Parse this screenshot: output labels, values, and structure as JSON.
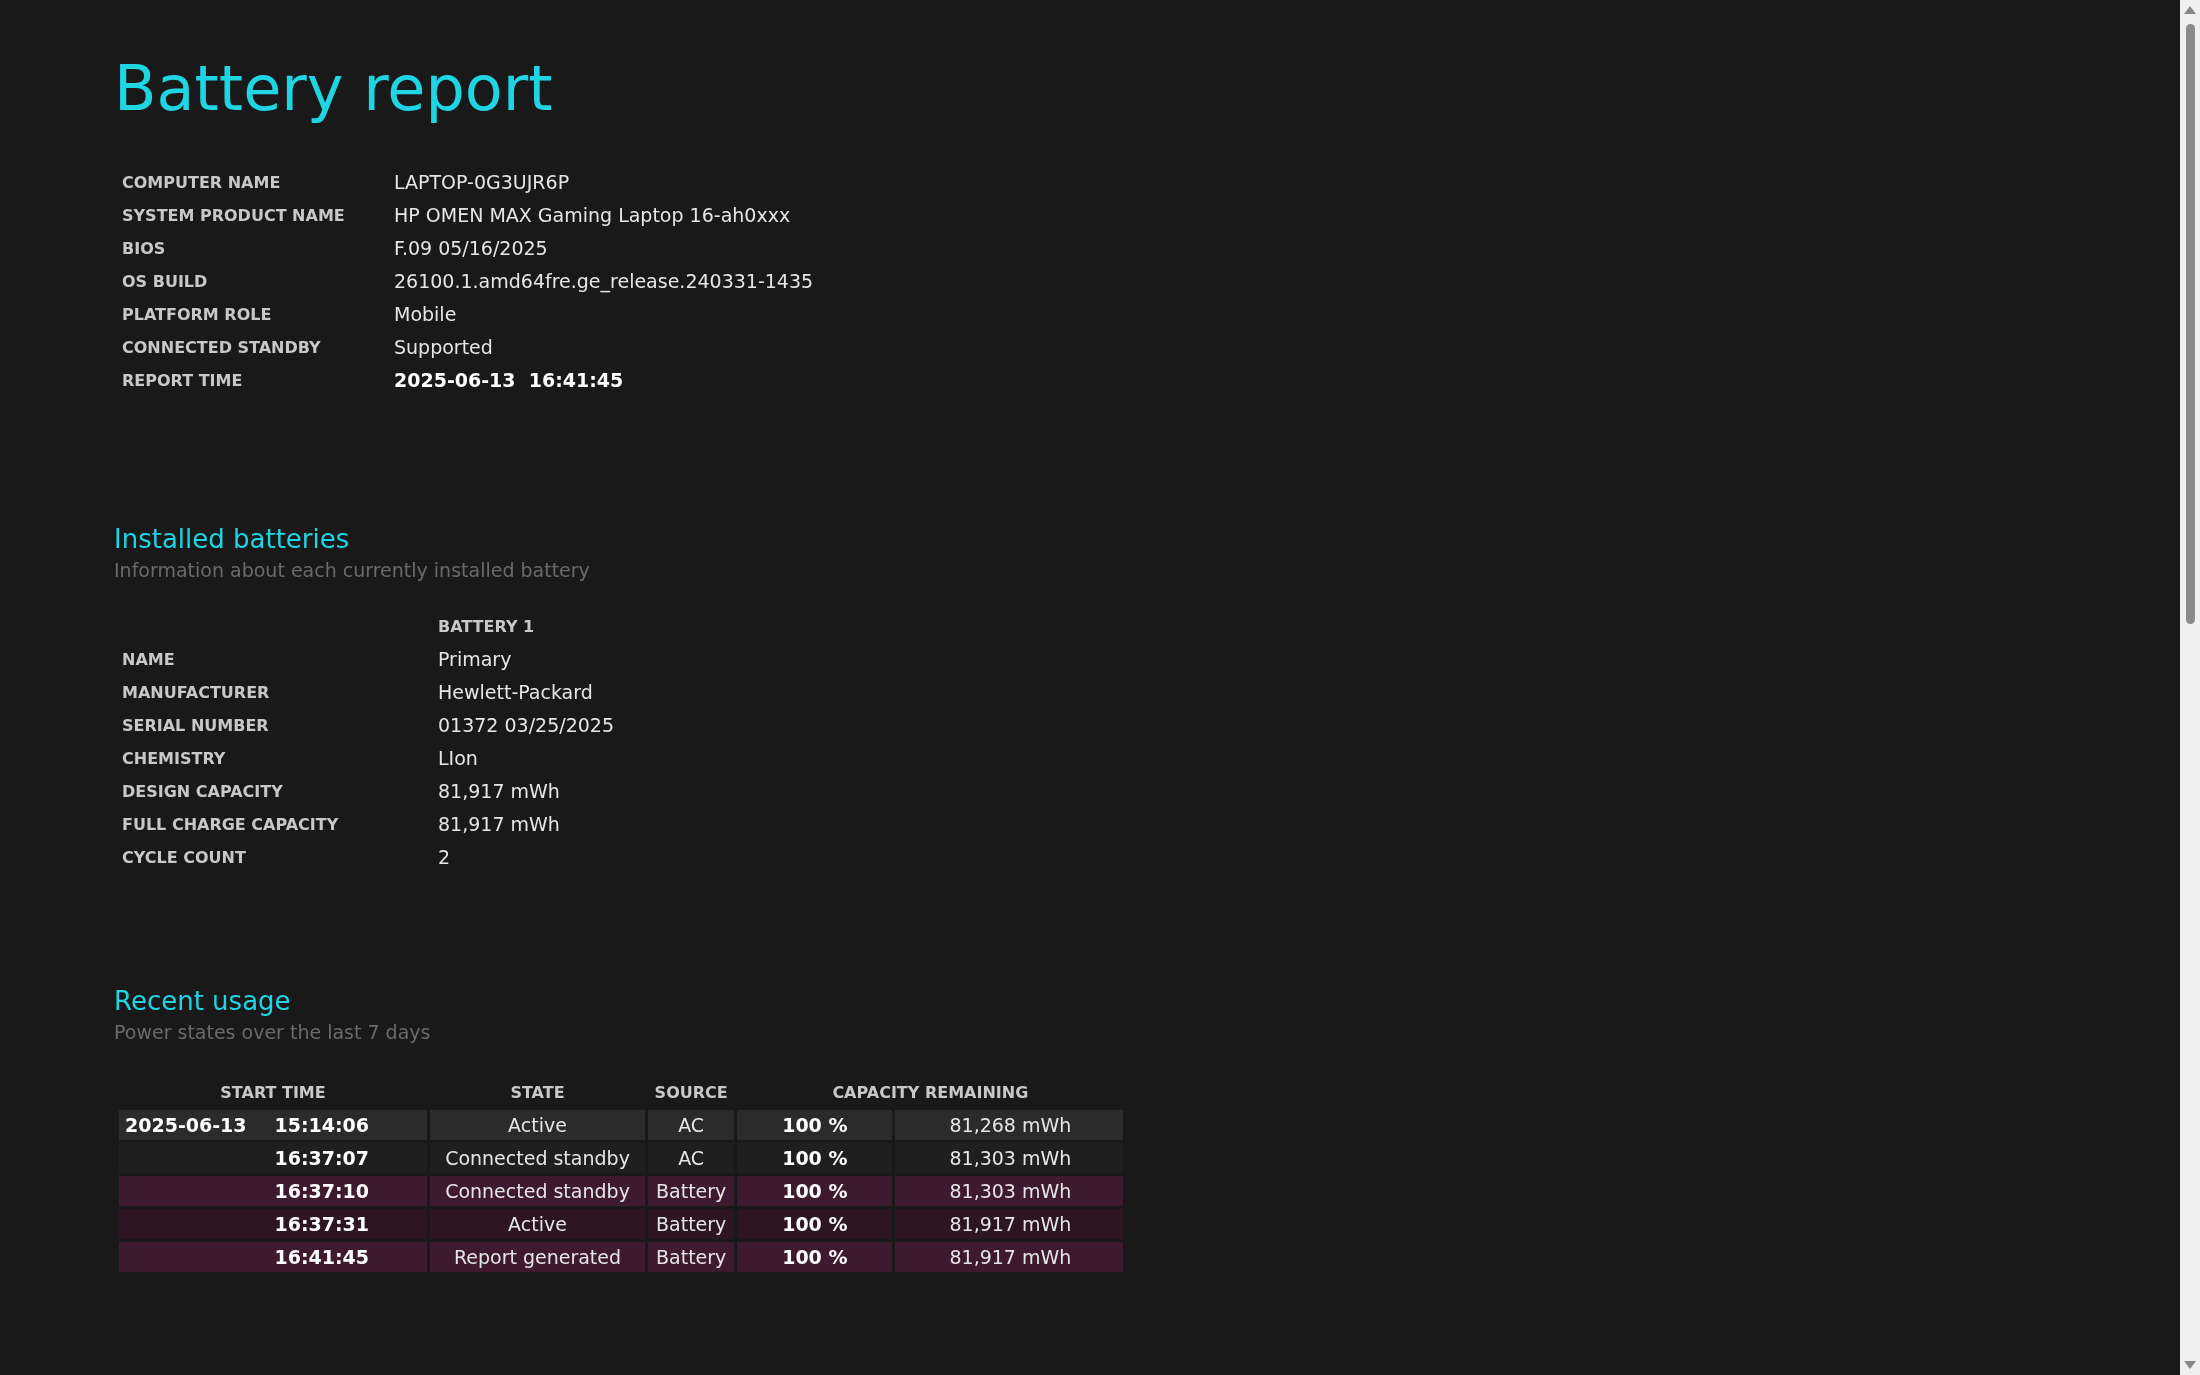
{
  "title": "Battery report",
  "system_info": [
    {
      "label": "COMPUTER NAME",
      "value": "LAPTOP-0G3UJR6P",
      "bold": false
    },
    {
      "label": "SYSTEM PRODUCT NAME",
      "value": "HP OMEN MAX Gaming Laptop 16-ah0xxx",
      "bold": false
    },
    {
      "label": "BIOS",
      "value": "F.09 05/16/2025",
      "bold": false
    },
    {
      "label": "OS BUILD",
      "value": "26100.1.amd64fre.ge_release.240331-1435",
      "bold": false
    },
    {
      "label": "PLATFORM ROLE",
      "value": "Mobile",
      "bold": false
    },
    {
      "label": "CONNECTED STANDBY",
      "value": "Supported",
      "bold": false
    },
    {
      "label": "REPORT TIME",
      "value": "2025-06-13  16:41:45",
      "bold": true
    }
  ],
  "installed_batteries": {
    "heading": "Installed batteries",
    "subtitle": "Information about each currently installed battery",
    "column": "BATTERY 1",
    "rows": [
      {
        "label": "NAME",
        "value": "Primary"
      },
      {
        "label": "MANUFACTURER",
        "value": "Hewlett-Packard"
      },
      {
        "label": "SERIAL NUMBER",
        "value": "01372 03/25/2025"
      },
      {
        "label": "CHEMISTRY",
        "value": "LIon"
      },
      {
        "label": "DESIGN CAPACITY",
        "value": "81,917 mWh"
      },
      {
        "label": "FULL CHARGE CAPACITY",
        "value": "81,917 mWh"
      },
      {
        "label": "CYCLE COUNT",
        "value": "2"
      }
    ]
  },
  "recent_usage": {
    "heading": "Recent usage",
    "subtitle": "Power states over the last 7 days",
    "columns": [
      "START TIME",
      "STATE",
      "SOURCE",
      "CAPACITY REMAINING"
    ],
    "rows": [
      {
        "kind": "ac",
        "date": "2025-06-13",
        "time": "15:14:06",
        "state": "Active",
        "source": "AC",
        "percent": "100 %",
        "capacity": "81,268 mWh"
      },
      {
        "kind": "ac",
        "time": "16:37:07",
        "state": "Connected standby",
        "source": "AC",
        "percent": "100 %",
        "capacity": "81,303 mWh"
      },
      {
        "kind": "battery",
        "time": "16:37:10",
        "state": "Connected standby",
        "source": "Battery",
        "percent": "100 %",
        "capacity": "81,303 mWh"
      },
      {
        "kind": "battery",
        "time": "16:37:31",
        "state": "Active",
        "source": "Battery",
        "percent": "100 %",
        "capacity": "81,917 mWh"
      },
      {
        "kind": "battery",
        "time": "16:41:45",
        "state": "Report generated",
        "source": "Battery",
        "percent": "100 %",
        "capacity": "81,917 mWh"
      }
    ]
  }
}
